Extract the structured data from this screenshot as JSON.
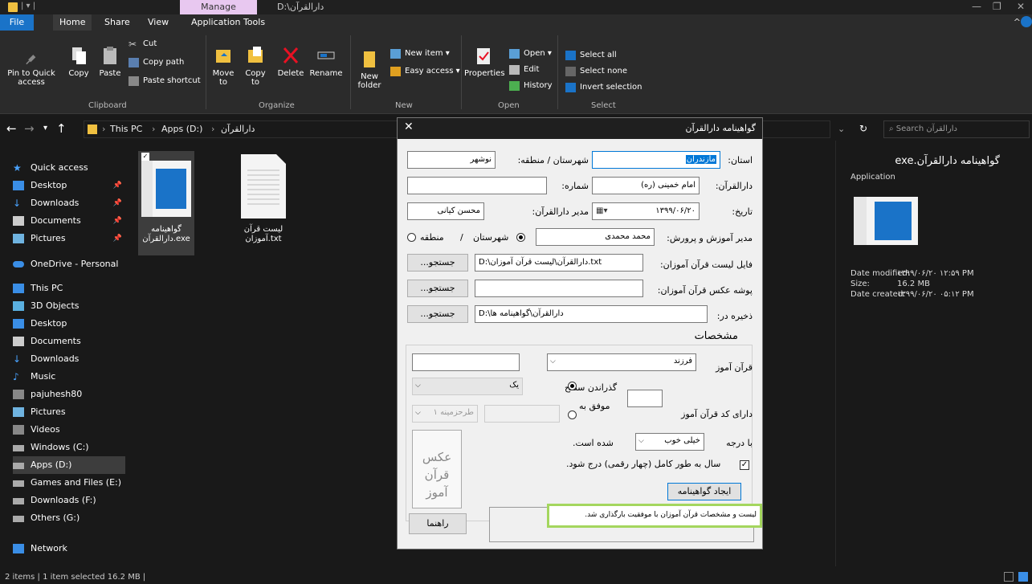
{
  "window": {
    "manage_tab": "Manage",
    "title_path": "D:\\دارالقرآن"
  },
  "ribbon_tabs": [
    "File",
    "Home",
    "Share",
    "View",
    "Application Tools"
  ],
  "ribbon": {
    "clipboard": {
      "pin": "Pin to Quick access",
      "copy": "Copy",
      "paste": "Paste",
      "cut": "Cut",
      "copy_path": "Copy path",
      "paste_shortcut": "Paste shortcut",
      "label": "Clipboard"
    },
    "organize": {
      "move_to": "Move to",
      "copy_to": "Copy to",
      "delete": "Delete",
      "rename": "Rename",
      "label": "Organize"
    },
    "new": {
      "new_folder": "New folder",
      "new_item": "New item",
      "easy_access": "Easy access",
      "label": "New"
    },
    "open": {
      "properties": "Properties",
      "open": "Open",
      "edit": "Edit",
      "history": "History",
      "label": "Open"
    },
    "select": {
      "select_all": "Select all",
      "select_none": "Select none",
      "invert": "Invert selection",
      "label": "Select"
    }
  },
  "address": {
    "crumbs": [
      "This PC",
      "Apps (D:)",
      "دارالقرآن"
    ],
    "search_placeholder": "Search دارالقرآن"
  },
  "sidebar": {
    "quick_access": "Quick access",
    "items": [
      {
        "label": "Desktop",
        "icon": "desktop-icon",
        "pinned": true
      },
      {
        "label": "Downloads",
        "icon": "download-icon",
        "pinned": true
      },
      {
        "label": "Documents",
        "icon": "documents-icon",
        "pinned": true
      },
      {
        "label": "Pictures",
        "icon": "pictures-icon",
        "pinned": true
      }
    ],
    "onedrive": "OneDrive - Personal",
    "this_pc": "This PC",
    "pc_items": [
      {
        "label": "3D Objects"
      },
      {
        "label": "Desktop"
      },
      {
        "label": "Documents"
      },
      {
        "label": "Downloads"
      },
      {
        "label": "Music"
      },
      {
        "label": "pajuhesh80"
      },
      {
        "label": "Pictures"
      },
      {
        "label": "Videos"
      },
      {
        "label": "Windows (C:)"
      },
      {
        "label": "Apps (D:)"
      },
      {
        "label": "Games and Files (E:)"
      },
      {
        "label": "Downloads (F:)"
      },
      {
        "label": "Others (G:)"
      }
    ],
    "network": "Network"
  },
  "files": [
    {
      "name_line1": "گواهینامه",
      "name_line2": "دارالقرآن.exe"
    },
    {
      "name_line1": "لیست قرآن",
      "name_line2": "آموزان.txt"
    }
  ],
  "preview": {
    "title": "گواهینامه دارالقرآن.exe",
    "type": "Application",
    "date_modified_label": "Date modified:",
    "date_modified": "۱۳۹۹/۰۶/۲۰ ۱۲:۵۹ PM",
    "size_label": "Size:",
    "size": "16.2 MB",
    "date_created_label": "Date created:",
    "date_created": "۱۳۹۹/۰۶/۲۰ ۰۵:۱۲ PM"
  },
  "status": "2 items  |  1 item selected  16.2 MB  |",
  "dialog": {
    "title": "گواهینامه دارالقرآن",
    "province_label": "استان:",
    "province_value": "مازندران",
    "city_label": "شهرستان / منطقه:",
    "city_value": "نوشهر",
    "darolquran_label": "دارالقرآن:",
    "darolquran_value": "امام خمینی (ره)",
    "number_label": "شماره:",
    "number_value": "",
    "date_label": "تاریخ:",
    "date_value": "۱۳۹۹/۰۶/۲۰",
    "manager_label": "مدیر دارالقرآن:",
    "manager_value": "محسن کیانی",
    "edu_manager_label": "مدیر آموزش و پرورش:",
    "edu_manager_value": "محمد محمدی",
    "radio_city": "شهرستان",
    "radio_sep": "/",
    "radio_region": "منطقه",
    "list_file_label": "فایل لیست قرآن آموزان:",
    "list_file_value": "D:\\دارالقرآن\\لیست قرآن آموزان.txt",
    "photo_folder_label": "پوشه عکس قرآن آموزان:",
    "photo_folder_value": "",
    "save_label": "ذخیره در:",
    "save_value": "D:\\دارالقرآن\\گواهینامه ها",
    "browse": "جستجو...",
    "specs_title": "مشخصات",
    "student_label": "قرآن آموز",
    "child_value": "فرزند",
    "code_label": "دارای کد قرآن آموز",
    "passed_level_label": "گذراندن سطح",
    "level_value": "یک",
    "success_label": "موفق به",
    "plan_value": "طرحزمینه ۱",
    "grade_prefix": "با درجه",
    "grade_value": "خیلی خوب",
    "grade_suffix": "شده است.",
    "full_year_label": "سال به طور کامل (چهار رقمی) درج شود.",
    "create_button": "ایجاد گواهینامه",
    "photo_placeholder": "عکس قرآن آموز",
    "help_button": "راهنما",
    "status_message": "لیست و مشخصات قرآن آموزان با موفقیت بارگذاری شد."
  }
}
